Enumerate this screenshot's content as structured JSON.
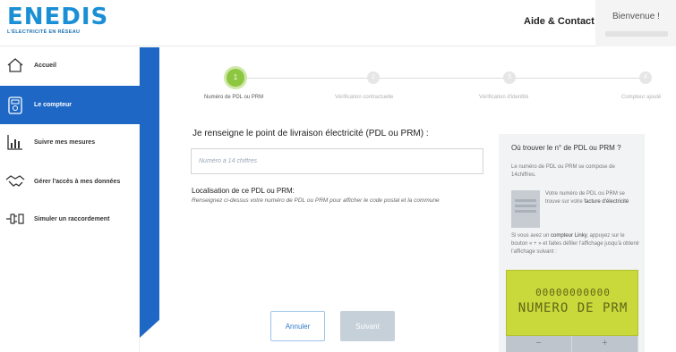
{
  "header": {
    "logo": "ENEDIS",
    "logo_tagline": "L'ÉLECTRICITÉ EN RÉSEAU",
    "aide_contact": "Aide & Contact",
    "bienvenue": "Bienvenue !"
  },
  "sidebar": {
    "items": [
      {
        "label": "Accueil",
        "icon": "home-icon"
      },
      {
        "label": "Le compteur",
        "icon": "meter-icon"
      },
      {
        "label": "Suivre mes mesures",
        "icon": "chart-icon"
      },
      {
        "label": "Gérer l'accès à mes données",
        "icon": "handshake-icon"
      },
      {
        "label": "Simuler un raccordement",
        "icon": "plug-icon"
      }
    ]
  },
  "stepper": {
    "steps": [
      {
        "number": "1",
        "label": "Numéro de PDL ou PRM"
      },
      {
        "number": "2",
        "label": "Vérification contractuelle"
      },
      {
        "number": "3",
        "label": "Vérification d'identité"
      },
      {
        "number": "4",
        "label": "Compteur ajouté"
      }
    ],
    "active_step": 1
  },
  "form": {
    "question": "Je renseigne le point de livraison électricité (PDL ou PRM) :",
    "pdl_placeholder": "Numéro à 14 chiffres",
    "pdl_value": "",
    "location_title": "Localisation de ce PDL ou PRM:",
    "location_desc": "Renseignez ci-dessus votre numéro de PDL ou PRM pour afficher le code postal et la commune",
    "cancel_label": "Annuler",
    "next_label": "Suivant"
  },
  "help": {
    "title": "Où trouver le n° de PDL ou PRM ?",
    "p1": "Le numéro de PDL ou PRM se compose de 14chiffres.",
    "p2_a": "Votre numéro de PDL ou PRM se trouve sur votre",
    "p2_b": "facture d'électricité",
    "p3_a": "Si vous avez un",
    "p3_b": "compteur Linky",
    "p3_c": ", appuyez sur le bouton « + » et faites défiler l'affichage jusqu'à obtenir l'affichage suivant :",
    "meter_line1": "00000000000",
    "meter_line2": "NUMERO DE PRM",
    "meter_minus": "−",
    "meter_plus": "+"
  },
  "colors": {
    "brand_blue": "#1e67c4",
    "step_green": "#8dc63f",
    "meter_lcd": "#c9d83a"
  }
}
